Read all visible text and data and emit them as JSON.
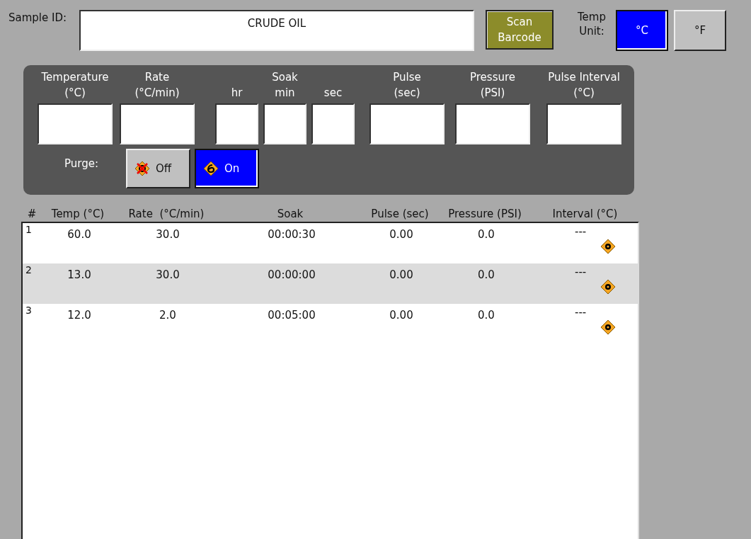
{
  "sample_id": {
    "label": "Sample ID:",
    "value": "CRUDE OIL"
  },
  "scan_button": {
    "lines": [
      "Scan",
      "Barcode"
    ]
  },
  "temp_unit": {
    "lines": [
      "Temp",
      "Unit:"
    ],
    "options": [
      {
        "label": "°C",
        "selected": true
      },
      {
        "label": "°F",
        "selected": false
      }
    ]
  },
  "step_fields": [
    {
      "kind": "field",
      "lines": [
        "Temperature",
        "(°C)"
      ]
    },
    {
      "kind": "field",
      "lines": [
        "Rate",
        "(°C/min)"
      ]
    },
    {
      "kind": "group",
      "label": "Soak",
      "parts": [
        {
          "label": "hr"
        },
        {
          "label": "min"
        },
        {
          "label": "sec"
        }
      ]
    },
    {
      "kind": "field",
      "lines": [
        "Pulse",
        "(sec)"
      ]
    },
    {
      "kind": "field",
      "lines": [
        "Pressure",
        "(PSI)"
      ]
    },
    {
      "kind": "field",
      "lines": [
        "Pulse Interval",
        "(°C)"
      ]
    }
  ],
  "purge": {
    "label": "Purge:",
    "options": [
      {
        "kind": "off",
        "label": "Off",
        "selected": false
      },
      {
        "kind": "on",
        "label": "On",
        "selected": true
      }
    ]
  },
  "table": {
    "columns": [
      "#",
      "Temp (°C)",
      "Rate  (°C/min)",
      "Soak",
      "Pulse (sec)",
      "Pressure (PSI)",
      "Interval (°C)"
    ],
    "rows": [
      {
        "number": "1",
        "temp": "60.0",
        "rate": "30.0",
        "soak": "00:00:30",
        "pulse": "0.00",
        "pressure": "0.0",
        "interval": "---",
        "selected": false
      },
      {
        "number": "2",
        "temp": "13.0",
        "rate": "30.0",
        "soak": "00:00:00",
        "pulse": "0.00",
        "pressure": "0.0",
        "interval": "---",
        "selected": true
      },
      {
        "number": "3",
        "temp": "12.0",
        "rate": "2.0",
        "soak": "00:05:00",
        "pulse": "0.00",
        "pressure": "0.0",
        "interval": "---",
        "selected": false
      }
    ]
  }
}
